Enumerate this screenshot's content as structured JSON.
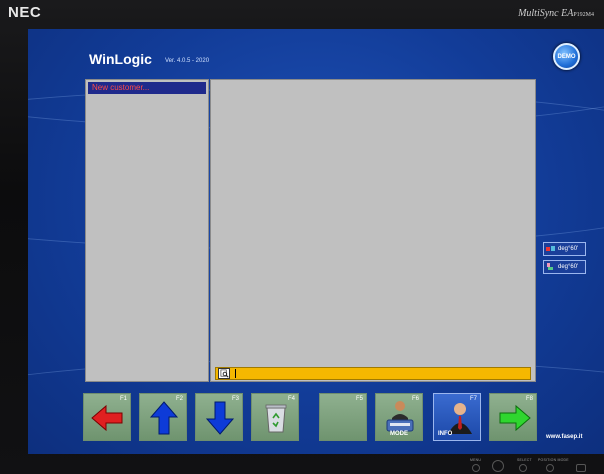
{
  "monitor": {
    "brand_left": "NEC",
    "brand_right": "MultiSync EA",
    "brand_right_model": "P192M4",
    "controls": [
      "MENU",
      "SELECT",
      "POSITION MODE"
    ]
  },
  "app": {
    "title": "WinLogic",
    "version": "Ver. 4.0.5 - 2020",
    "demo_badge": "DEMO",
    "website": "www.fasep.it"
  },
  "customer_list": {
    "selected_item": "New customer..."
  },
  "search": {
    "value": ""
  },
  "side_indicators": [
    {
      "label": "deg°60'"
    },
    {
      "label": "deg°60'"
    }
  ],
  "function_keys": [
    {
      "key": "F1",
      "icon": "arrow-left-icon",
      "caption": ""
    },
    {
      "key": "F2",
      "icon": "arrow-up-icon",
      "caption": ""
    },
    {
      "key": "F3",
      "icon": "arrow-down-icon",
      "caption": ""
    },
    {
      "key": "F4",
      "icon": "recycle-bin-icon",
      "caption": ""
    },
    {
      "key": "F5",
      "icon": "",
      "caption": ""
    },
    {
      "key": "F6",
      "icon": "mode-technician-icon",
      "caption": "MODE"
    },
    {
      "key": "F7",
      "icon": "info-user-icon",
      "caption": "INFO"
    },
    {
      "key": "F8",
      "icon": "arrow-right-icon",
      "caption": ""
    }
  ],
  "colors": {
    "screen_bg": "#123c98",
    "panel_bg": "#c0c0c0",
    "selected_bg": "#1f2a8c",
    "selected_text": "#ff4a4a",
    "search_bar": "#f5b800",
    "fkey_green": "#7fa27f",
    "fkey_blue": "#2a5cc0"
  }
}
